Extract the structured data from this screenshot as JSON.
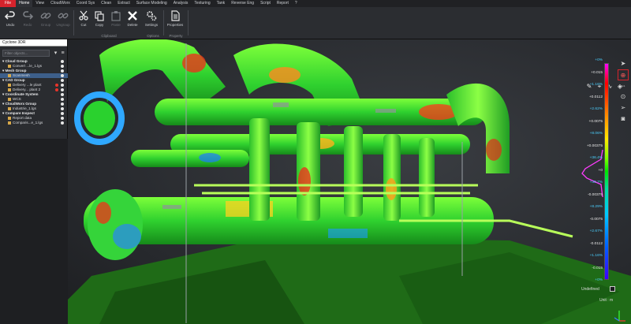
{
  "menu": {
    "items": [
      "File",
      "Home",
      "View",
      "CloudWorx",
      "Coord Sys",
      "Clean",
      "Extract",
      "Surface Modeling",
      "Analysis",
      "Texturing",
      "Tank",
      "Reverse Eng",
      "Script",
      "Report",
      "?"
    ],
    "active": "Home"
  },
  "ribbon": {
    "buttons": {
      "undo": "Undo",
      "redo": "Redo",
      "group": "Group",
      "ungroup": "Ungroup",
      "cut": "Cut",
      "copy": "Copy",
      "paste": "Paste",
      "delete": "Delete",
      "settings": "Settings",
      "properties": "Properties"
    },
    "groups": {
      "clipboard": "Clipboard",
      "options": "Options",
      "property": "Property"
    }
  },
  "panel": {
    "title": "Cyclone 3DR",
    "filter_placeholder": "Filter objects...",
    "tree": [
      {
        "label": "Cloud Group",
        "type": "group"
      },
      {
        "label": "Convert ...le_1.lgs",
        "type": "item"
      },
      {
        "label": "Mesh Group",
        "type": "group"
      },
      {
        "label": "Scanmesh",
        "type": "item",
        "selected": true
      },
      {
        "label": "CAD Group",
        "type": "group"
      },
      {
        "label": "Delivery ...le plant",
        "type": "item"
      },
      {
        "label": "Delivery... plant 2",
        "type": "item"
      },
      {
        "label": "Coordinate System",
        "type": "group"
      },
      {
        "label": "WCS",
        "type": "item"
      },
      {
        "label": "CloudWorx Group",
        "type": "group"
      },
      {
        "label": "Industrie_1.lgs",
        "type": "item"
      },
      {
        "label": "Compare Inspect",
        "type": "group"
      },
      {
        "label": "Report data",
        "type": "item"
      },
      {
        "label": "Comparis...e_1.lgs",
        "type": "item"
      }
    ]
  },
  "scale": {
    "ticks": [
      {
        "label": "+0%",
        "color": "#4bd0ff"
      },
      {
        "label": "+0.015",
        "color": "#e8e8e8"
      },
      {
        "label": "+1.16%",
        "color": "#4bd0ff"
      },
      {
        "label": "+0.0112",
        "color": "#e8e8e8"
      },
      {
        "label": "+2.62%",
        "color": "#4bd0ff"
      },
      {
        "label": "+0.0075",
        "color": "#e8e8e8"
      },
      {
        "label": "+8.06%",
        "color": "#4bd0ff"
      },
      {
        "label": "+0.00375",
        "color": "#e8e8e8"
      },
      {
        "label": "+36.4%",
        "color": "#4bd0ff"
      },
      {
        "label": "+0",
        "color": "#e8e8e8"
      },
      {
        "label": "+30.7%",
        "color": "#4bd0ff"
      },
      {
        "label": "-0.00375",
        "color": "#e8e8e8"
      },
      {
        "label": "+8.29%",
        "color": "#4bd0ff"
      },
      {
        "label": "-0.0075",
        "color": "#e8e8e8"
      },
      {
        "label": "+2.67%",
        "color": "#4bd0ff"
      },
      {
        "label": "-0.0112",
        "color": "#e8e8e8"
      },
      {
        "label": "+1.16%",
        "color": "#4bd0ff"
      },
      {
        "label": "-0.015",
        "color": "#e8e8e8"
      },
      {
        "label": "+0%",
        "color": "#4bd0ff"
      }
    ],
    "undefined_label": "Undefined",
    "unit_label": "Unit : m"
  },
  "colors": {
    "accent": "#d6232c",
    "panel_bg": "#2a2c30",
    "selection": "#3d5f8a"
  },
  "icons": {
    "viewport_tools": [
      "ruler-icon",
      "measure-icon",
      "lasso-icon",
      "paint-icon"
    ],
    "right_tools": [
      "pointer-icon",
      "target-icon",
      "fit-icon",
      "zoom-icon",
      "navigate-icon",
      "camera-icon"
    ]
  }
}
